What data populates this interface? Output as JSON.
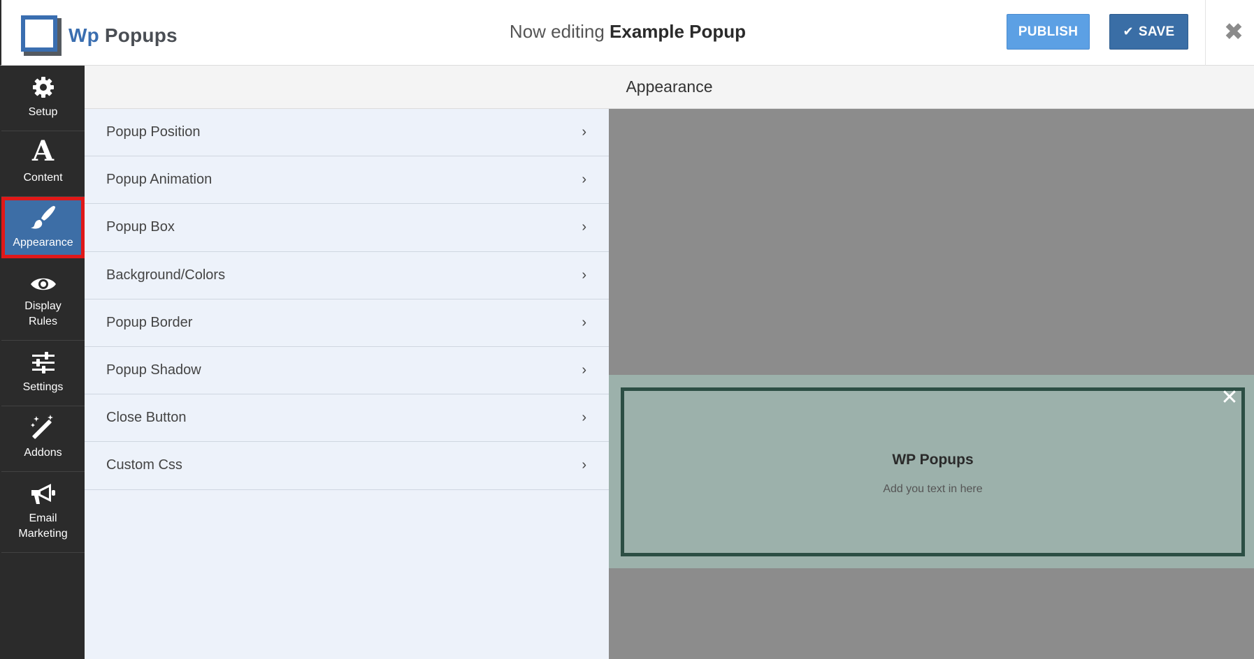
{
  "header": {
    "logo_wp": "Wp",
    "logo_popups": "Popups",
    "editing_prefix": "Now editing",
    "popup_name": "Example Popup",
    "publish_label": "PUBLISH",
    "save_label": "SAVE"
  },
  "sidebar": {
    "items": [
      {
        "label": "Setup",
        "icon": "gear-icon"
      },
      {
        "label": "Content",
        "icon": "font-a-icon"
      },
      {
        "label": "Appearance",
        "icon": "paintbrush-icon",
        "active": true
      },
      {
        "label": "Display\nRules",
        "icon": "eye-icon"
      },
      {
        "label": "Settings",
        "icon": "sliders-icon"
      },
      {
        "label": "Addons",
        "icon": "magic-wand-icon"
      },
      {
        "label": "Email\nMarketing",
        "icon": "megaphone-icon"
      }
    ]
  },
  "panel": {
    "title": "Appearance",
    "options": [
      "Popup Position",
      "Popup Animation",
      "Popup Box",
      "Background/Colors",
      "Popup Border",
      "Popup Shadow",
      "Close Button",
      "Custom Css"
    ]
  },
  "preview": {
    "popup_title": "WP Popups",
    "popup_text": "Add you text in here"
  },
  "colors": {
    "brand_blue": "#3a6eb0",
    "publish": "#5ca0e4",
    "save": "#3a6ea6",
    "sidebar": "#2b2b2b",
    "active_item": "#3d6ea6",
    "highlight_border": "#e01818",
    "panel_bg": "#edf2fa",
    "preview_bg": "#8c8c8c",
    "popup_bg": "#9cb1ab",
    "popup_border": "#2c4e44"
  }
}
